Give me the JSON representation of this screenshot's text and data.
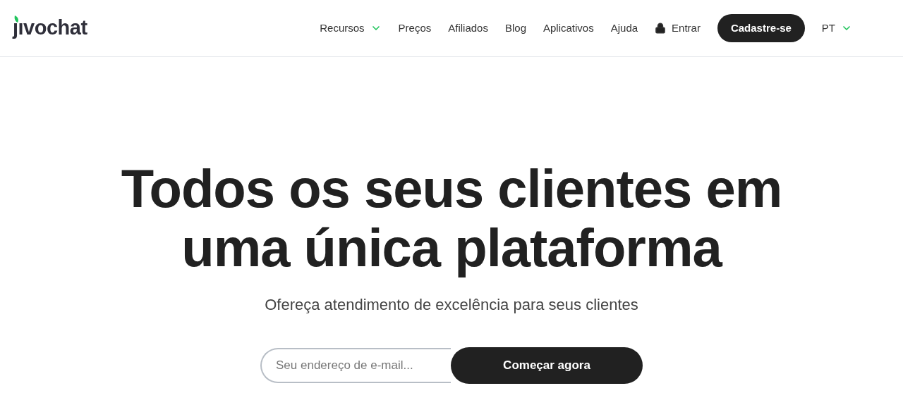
{
  "header": {
    "logo": "ȷıvochat",
    "nav": [
      {
        "kind": "dropdown",
        "label": "Recursos"
      },
      {
        "kind": "link",
        "label": "Preços"
      },
      {
        "kind": "link",
        "label": "Afiliados"
      },
      {
        "kind": "link",
        "label": "Blog"
      },
      {
        "kind": "link",
        "label": "Aplicativos"
      },
      {
        "kind": "link",
        "label": "Ajuda"
      },
      {
        "kind": "login",
        "label": "Entrar"
      },
      {
        "kind": "button",
        "label": "Cadastre-se"
      },
      {
        "kind": "dropdown",
        "label": "PT"
      }
    ]
  },
  "hero": {
    "title_lines": [
      "Todos os seus clientes em",
      "uma única plataforma"
    ],
    "subtitle": "Ofereça atendimento de excelência para seus clientes",
    "email": {
      "placeholder": "Seu endereço de e-mail..."
    },
    "cta": "Começar agora"
  }
}
